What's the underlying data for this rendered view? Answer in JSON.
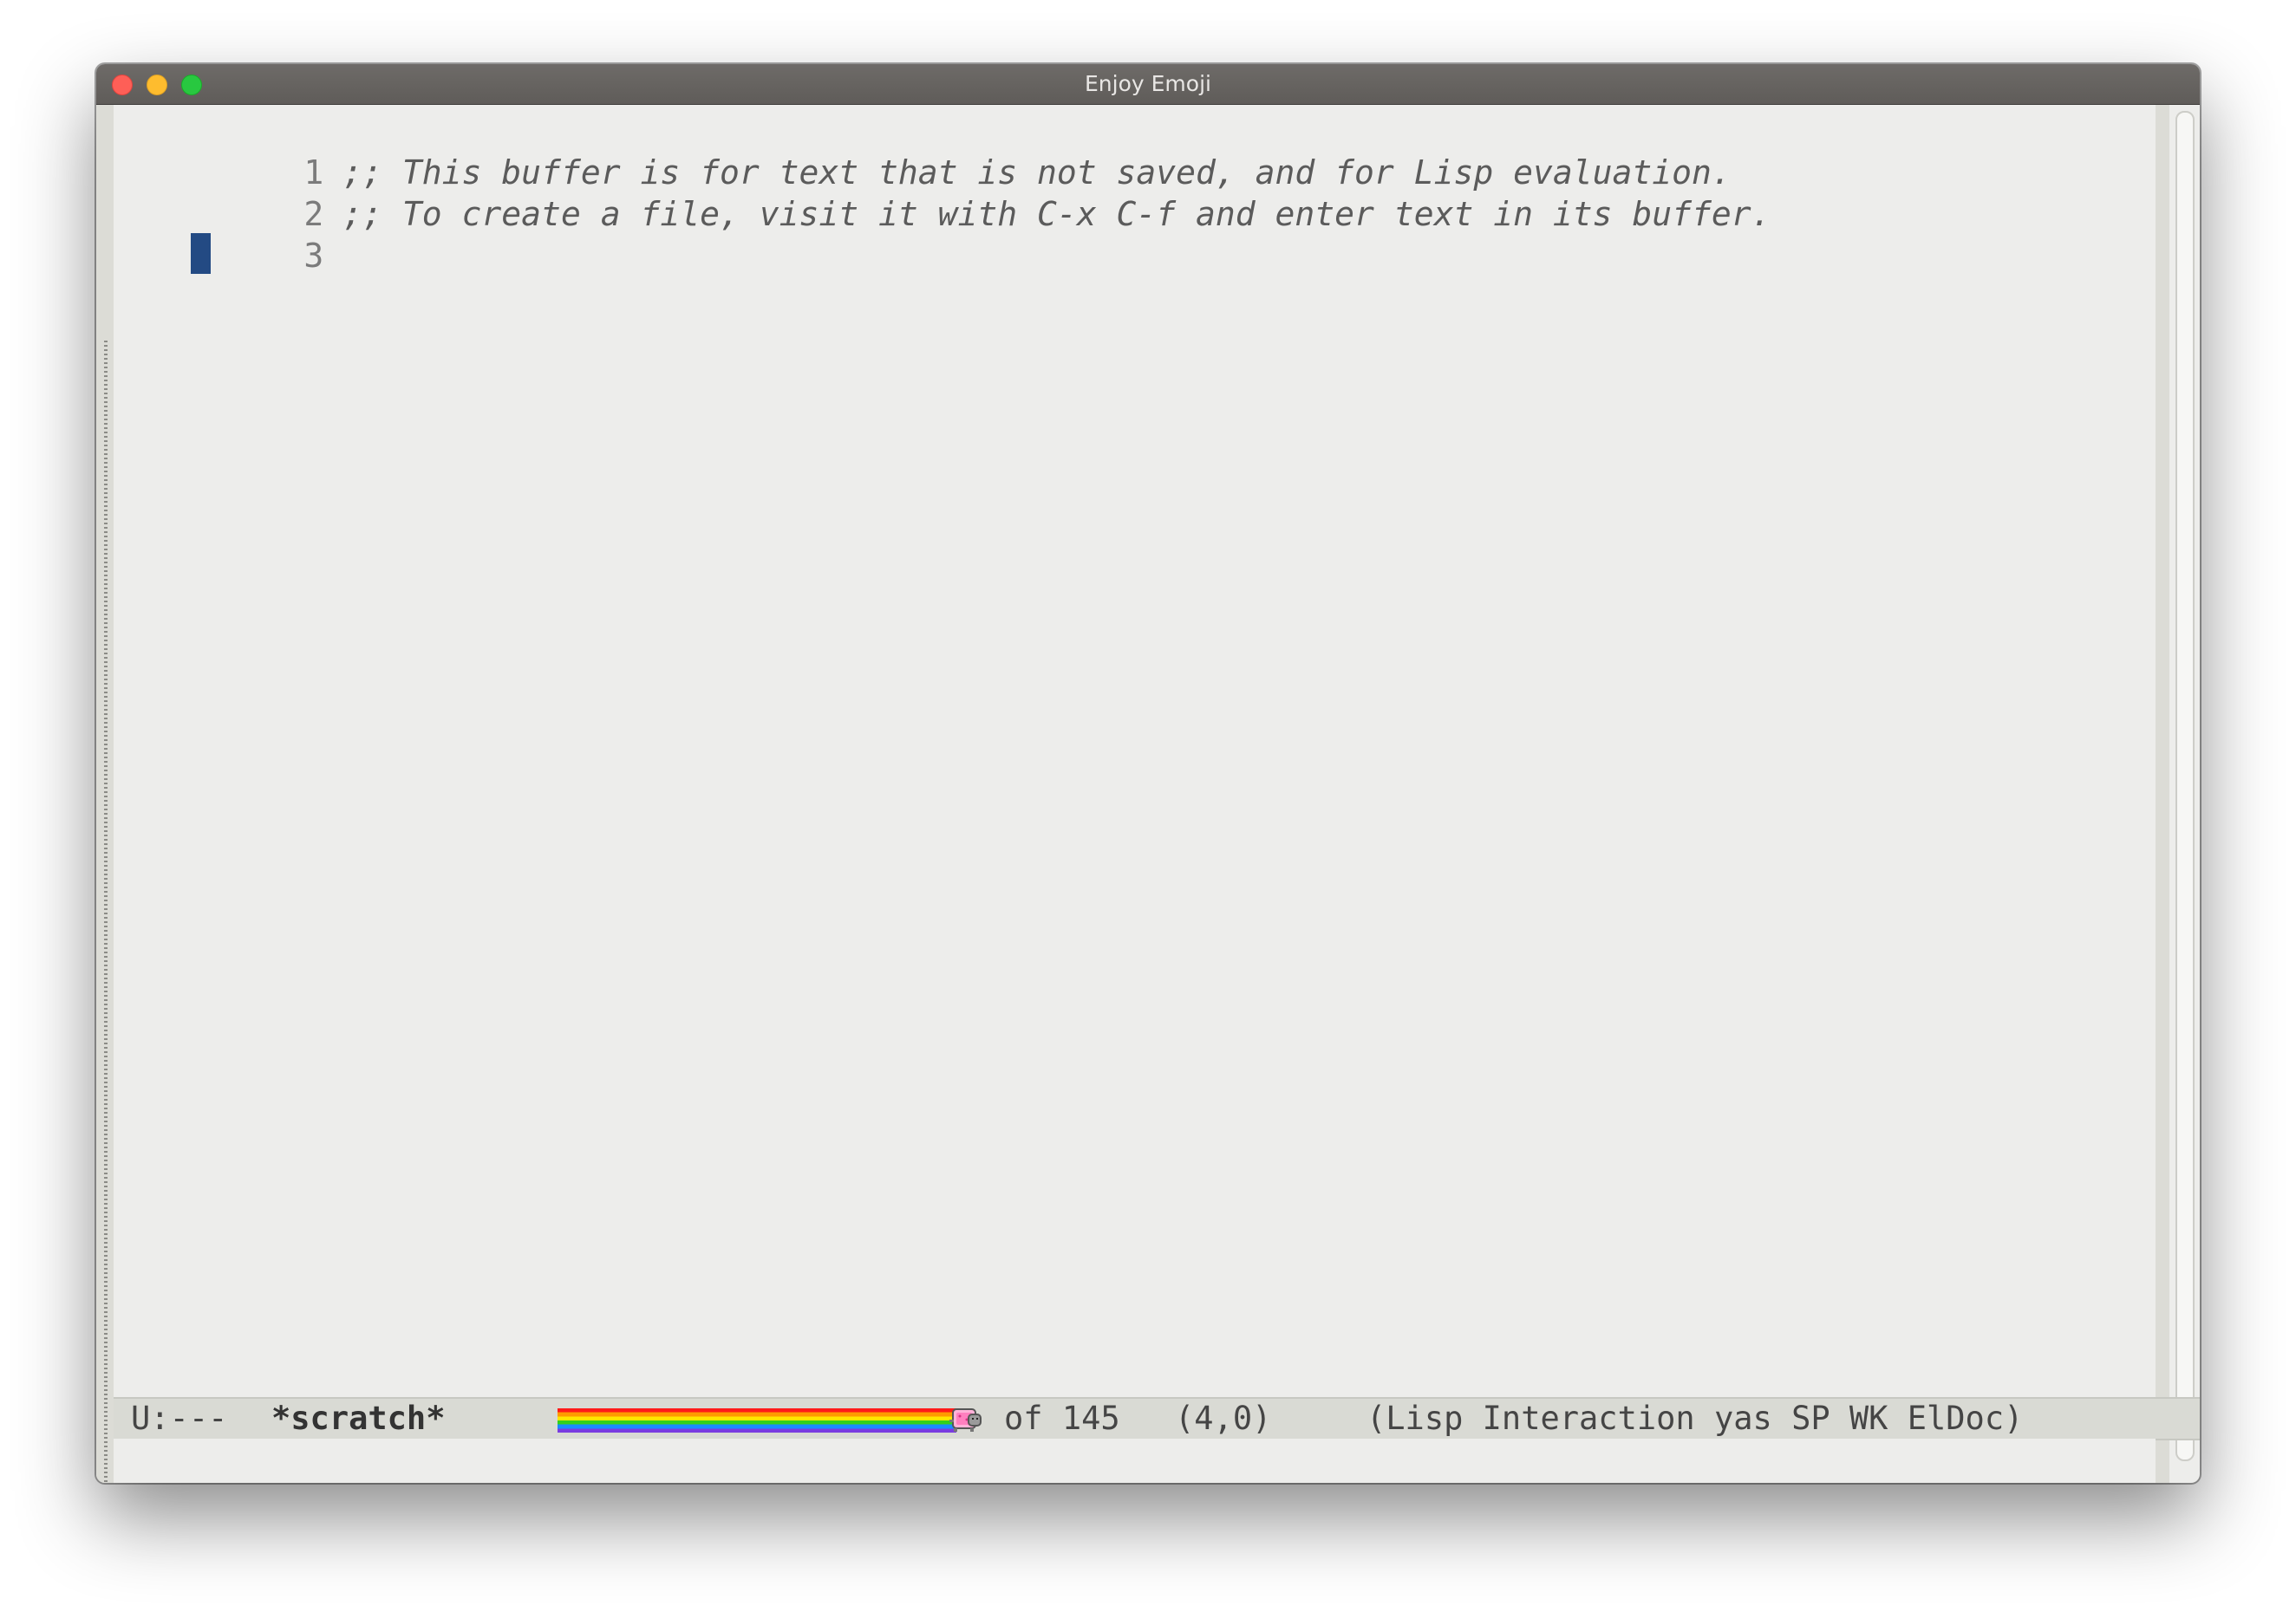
{
  "window": {
    "title": "Enjoy Emoji"
  },
  "buffer": {
    "lines": [
      {
        "num": "1",
        "text": ";; This buffer is for text that is not saved, and for Lisp evaluation."
      },
      {
        "num": "2",
        "text": ";; To create a file, visit it with C-x C-f and enter text in its buffer."
      },
      {
        "num": "3",
        "text": ""
      }
    ]
  },
  "modeline": {
    "status": "U:---",
    "buffer_name": "*scratch*",
    "position": "of 145",
    "cursor_pos": "(4,0)",
    "modes": "(Lisp Interaction yas SP WK ElDoc)",
    "nyan_icon": "nyan-cat-icon"
  },
  "echo_area": {
    "text": ""
  },
  "colors": {
    "cursor": "#234a83",
    "background": "#ededeb",
    "modeline_bg": "#d9dad4"
  }
}
